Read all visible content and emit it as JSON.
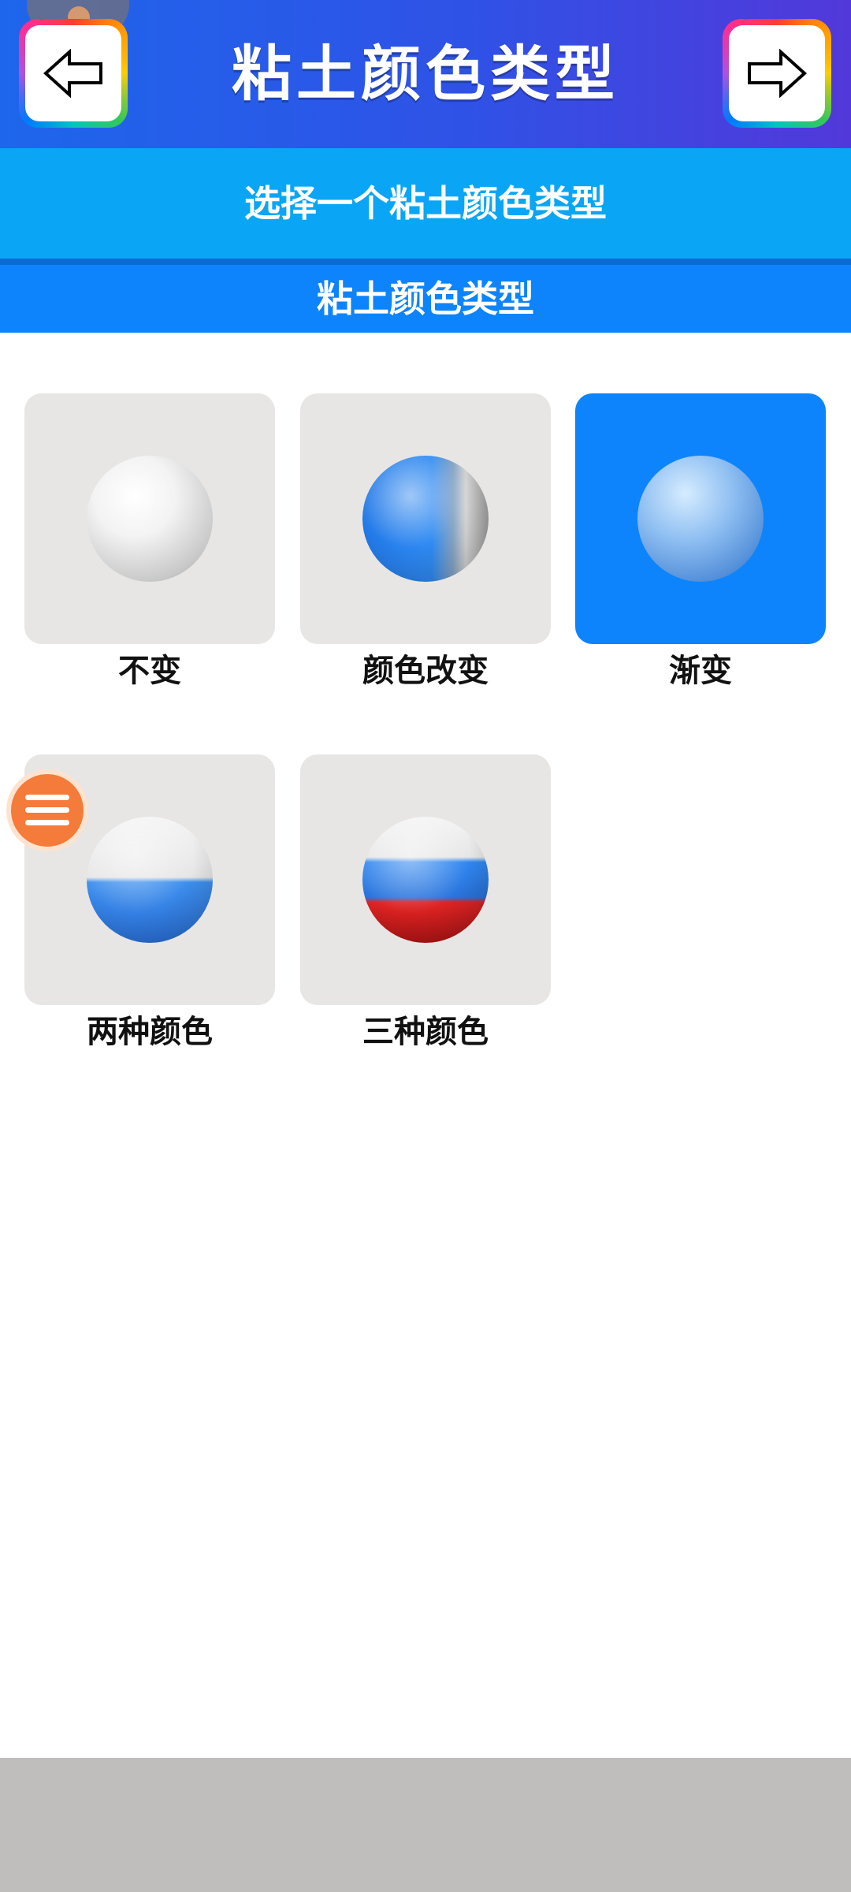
{
  "header": {
    "title": "粘土颜色类型",
    "back_icon": "arrow-left-icon",
    "next_icon": "arrow-right-icon"
  },
  "subheader": {
    "instruction": "选择一个粘土颜色类型"
  },
  "section": {
    "title": "粘土颜色类型"
  },
  "options": [
    {
      "label": "不变",
      "icon": "white-sphere-icon",
      "selected": false
    },
    {
      "label": "颜色改变",
      "icon": "blue-white-sphere-icon",
      "selected": false
    },
    {
      "label": "渐变",
      "icon": "gradient-sphere-icon",
      "selected": true
    },
    {
      "label": "两种颜色",
      "icon": "two-color-sphere-icon",
      "selected": false
    },
    {
      "label": "三种颜色",
      "icon": "three-color-sphere-icon",
      "selected": false
    }
  ],
  "floating_menu": {
    "icon": "hamburger-menu-icon"
  },
  "colors": {
    "header": "#2f52e6",
    "subheader": "#0aa6f5",
    "section_bar": "#0d84fb",
    "selected_tile": "#0d84fb",
    "tile": "#e7e6e4",
    "fab": "#f47b3a"
  }
}
